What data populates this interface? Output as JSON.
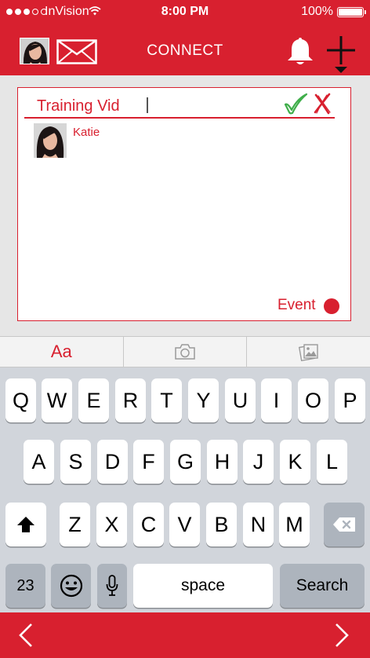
{
  "status_bar": {
    "carrier": "InVision",
    "time": "8:00 PM",
    "battery": "100%",
    "signal_bars": 3,
    "signal_total": 5
  },
  "header": {
    "title": "CONNECT",
    "icons": [
      "avatar",
      "mail-icon",
      "bell-icon",
      "plus-icon"
    ]
  },
  "compose": {
    "title_value": "Training Vid",
    "recipient_name": "Katie",
    "event_label": "Event"
  },
  "toolbar": {
    "text_format_label": "Aa",
    "icons": [
      "camera-icon",
      "photo-gallery-icon"
    ]
  },
  "keyboard": {
    "row1": [
      "Q",
      "W",
      "E",
      "R",
      "T",
      "Y",
      "U",
      "I",
      "O",
      "P"
    ],
    "row2": [
      "A",
      "S",
      "D",
      "F",
      "G",
      "H",
      "J",
      "K",
      "L"
    ],
    "row3": [
      "Z",
      "X",
      "C",
      "V",
      "B",
      "N",
      "M"
    ],
    "numbers_label": "23",
    "space_label": "space",
    "action_label": "Search"
  },
  "bottom_nav": {
    "icons": [
      "chevron-left-icon",
      "chevron-right-icon"
    ]
  },
  "colors": {
    "brand_red": "#d8202f",
    "confirm_green": "#3fae4a",
    "keyboard_bg": "#d1d5db",
    "key_dark": "#adb4bd"
  }
}
